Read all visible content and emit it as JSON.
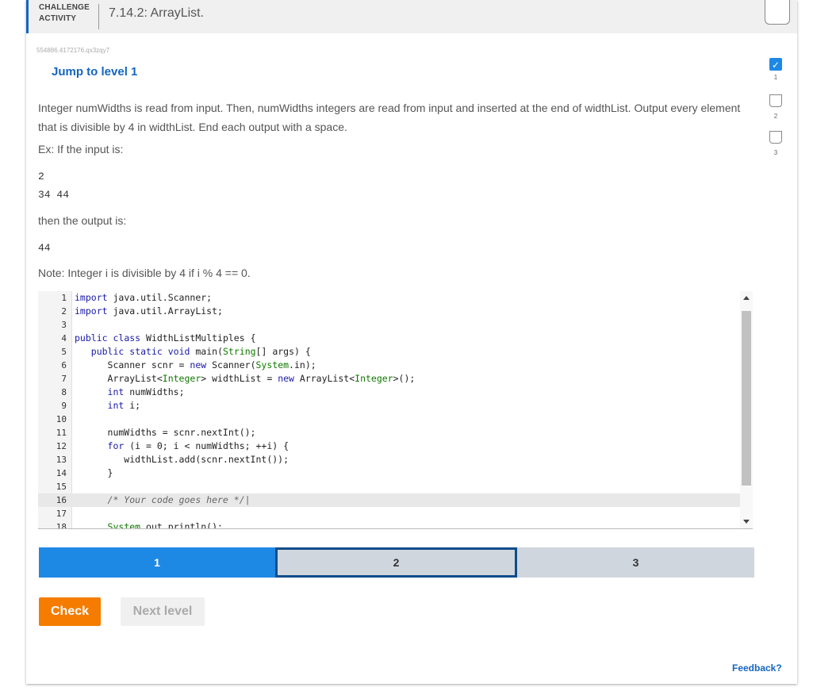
{
  "header": {
    "activity_label_1": "CHALLENGE",
    "activity_label_2": "ACTIVITY",
    "title": "7.14.2: ArrayList."
  },
  "activity_id": "554886.4172176.qx3zqy7",
  "jump_link": "Jump to level 1",
  "levels": [
    {
      "number": "1",
      "completed": true,
      "check": "✓"
    },
    {
      "number": "2",
      "completed": false
    },
    {
      "number": "3",
      "completed": false
    }
  ],
  "prompt": {
    "description": "Integer numWidths is read from input. Then, numWidths integers are read from input and inserted at the end of widthList. Output every element that is divisible by 4 in widthList. End each output with a space.",
    "example_label": "Ex: If the input is:",
    "input_line_1": "2",
    "input_line_2": "34 44",
    "then_label": "then the output is:",
    "output_line_1": "44",
    "note": "Note: Integer i is divisible by 4 if i % 4 == 0."
  },
  "code": [
    {
      "n": "1",
      "t": "import java.util.Scanner;"
    },
    {
      "n": "2",
      "t": "import java.util.ArrayList;"
    },
    {
      "n": "3",
      "t": ""
    },
    {
      "n": "4",
      "t": "public class WidthListMultiples {"
    },
    {
      "n": "5",
      "t": "   public static void main(String[] args) {"
    },
    {
      "n": "6",
      "t": "      Scanner scnr = new Scanner(System.in);"
    },
    {
      "n": "7",
      "t": "      ArrayList<Integer> widthList = new ArrayList<Integer>();"
    },
    {
      "n": "8",
      "t": "      int numWidths;"
    },
    {
      "n": "9",
      "t": "      int i;"
    },
    {
      "n": "10",
      "t": ""
    },
    {
      "n": "11",
      "t": "      numWidths = scnr.nextInt();"
    },
    {
      "n": "12",
      "t": "      for (i = 0; i < numWidths; ++i) {"
    },
    {
      "n": "13",
      "t": "         widthList.add(scnr.nextInt());"
    },
    {
      "n": "14",
      "t": "      }"
    },
    {
      "n": "15",
      "t": ""
    },
    {
      "n": "16",
      "t": "      /* Your code goes here */|"
    },
    {
      "n": "17",
      "t": ""
    },
    {
      "n": "18",
      "t": "      System.out.println();"
    }
  ],
  "active_line": "16",
  "progress": {
    "segments": [
      "1",
      "2",
      "3"
    ],
    "current": "2"
  },
  "buttons": {
    "check": "Check",
    "next_level": "Next level"
  },
  "feedback": "Feedback?",
  "colors": {
    "accent": "#1e88e5",
    "link": "#1565c0",
    "check_button": "#f57c00"
  }
}
